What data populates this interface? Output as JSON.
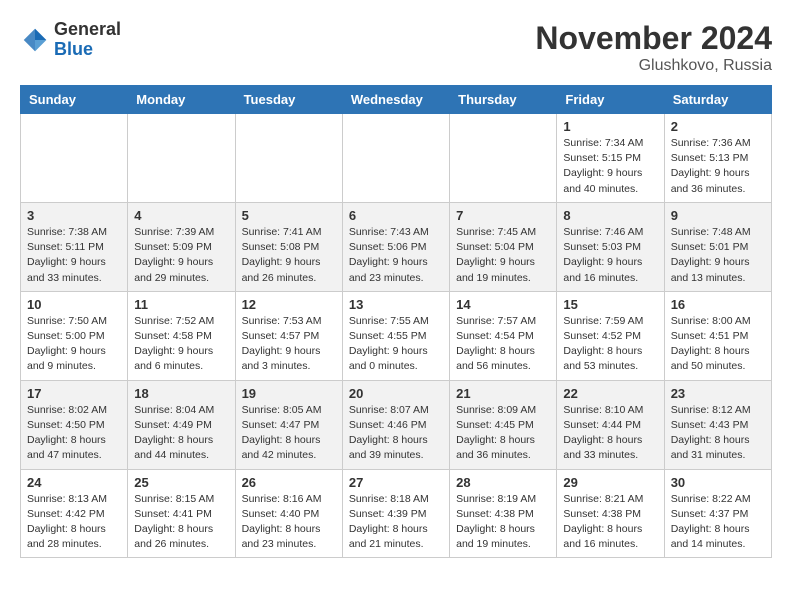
{
  "header": {
    "logo_general": "General",
    "logo_blue": "Blue",
    "month_title": "November 2024",
    "location": "Glushkovo, Russia"
  },
  "days_of_week": [
    "Sunday",
    "Monday",
    "Tuesday",
    "Wednesday",
    "Thursday",
    "Friday",
    "Saturday"
  ],
  "weeks": [
    [
      {
        "day": "",
        "info": ""
      },
      {
        "day": "",
        "info": ""
      },
      {
        "day": "",
        "info": ""
      },
      {
        "day": "",
        "info": ""
      },
      {
        "day": "",
        "info": ""
      },
      {
        "day": "1",
        "info": "Sunrise: 7:34 AM\nSunset: 5:15 PM\nDaylight: 9 hours and 40 minutes."
      },
      {
        "day": "2",
        "info": "Sunrise: 7:36 AM\nSunset: 5:13 PM\nDaylight: 9 hours and 36 minutes."
      }
    ],
    [
      {
        "day": "3",
        "info": "Sunrise: 7:38 AM\nSunset: 5:11 PM\nDaylight: 9 hours and 33 minutes."
      },
      {
        "day": "4",
        "info": "Sunrise: 7:39 AM\nSunset: 5:09 PM\nDaylight: 9 hours and 29 minutes."
      },
      {
        "day": "5",
        "info": "Sunrise: 7:41 AM\nSunset: 5:08 PM\nDaylight: 9 hours and 26 minutes."
      },
      {
        "day": "6",
        "info": "Sunrise: 7:43 AM\nSunset: 5:06 PM\nDaylight: 9 hours and 23 minutes."
      },
      {
        "day": "7",
        "info": "Sunrise: 7:45 AM\nSunset: 5:04 PM\nDaylight: 9 hours and 19 minutes."
      },
      {
        "day": "8",
        "info": "Sunrise: 7:46 AM\nSunset: 5:03 PM\nDaylight: 9 hours and 16 minutes."
      },
      {
        "day": "9",
        "info": "Sunrise: 7:48 AM\nSunset: 5:01 PM\nDaylight: 9 hours and 13 minutes."
      }
    ],
    [
      {
        "day": "10",
        "info": "Sunrise: 7:50 AM\nSunset: 5:00 PM\nDaylight: 9 hours and 9 minutes."
      },
      {
        "day": "11",
        "info": "Sunrise: 7:52 AM\nSunset: 4:58 PM\nDaylight: 9 hours and 6 minutes."
      },
      {
        "day": "12",
        "info": "Sunrise: 7:53 AM\nSunset: 4:57 PM\nDaylight: 9 hours and 3 minutes."
      },
      {
        "day": "13",
        "info": "Sunrise: 7:55 AM\nSunset: 4:55 PM\nDaylight: 9 hours and 0 minutes."
      },
      {
        "day": "14",
        "info": "Sunrise: 7:57 AM\nSunset: 4:54 PM\nDaylight: 8 hours and 56 minutes."
      },
      {
        "day": "15",
        "info": "Sunrise: 7:59 AM\nSunset: 4:52 PM\nDaylight: 8 hours and 53 minutes."
      },
      {
        "day": "16",
        "info": "Sunrise: 8:00 AM\nSunset: 4:51 PM\nDaylight: 8 hours and 50 minutes."
      }
    ],
    [
      {
        "day": "17",
        "info": "Sunrise: 8:02 AM\nSunset: 4:50 PM\nDaylight: 8 hours and 47 minutes."
      },
      {
        "day": "18",
        "info": "Sunrise: 8:04 AM\nSunset: 4:49 PM\nDaylight: 8 hours and 44 minutes."
      },
      {
        "day": "19",
        "info": "Sunrise: 8:05 AM\nSunset: 4:47 PM\nDaylight: 8 hours and 42 minutes."
      },
      {
        "day": "20",
        "info": "Sunrise: 8:07 AM\nSunset: 4:46 PM\nDaylight: 8 hours and 39 minutes."
      },
      {
        "day": "21",
        "info": "Sunrise: 8:09 AM\nSunset: 4:45 PM\nDaylight: 8 hours and 36 minutes."
      },
      {
        "day": "22",
        "info": "Sunrise: 8:10 AM\nSunset: 4:44 PM\nDaylight: 8 hours and 33 minutes."
      },
      {
        "day": "23",
        "info": "Sunrise: 8:12 AM\nSunset: 4:43 PM\nDaylight: 8 hours and 31 minutes."
      }
    ],
    [
      {
        "day": "24",
        "info": "Sunrise: 8:13 AM\nSunset: 4:42 PM\nDaylight: 8 hours and 28 minutes."
      },
      {
        "day": "25",
        "info": "Sunrise: 8:15 AM\nSunset: 4:41 PM\nDaylight: 8 hours and 26 minutes."
      },
      {
        "day": "26",
        "info": "Sunrise: 8:16 AM\nSunset: 4:40 PM\nDaylight: 8 hours and 23 minutes."
      },
      {
        "day": "27",
        "info": "Sunrise: 8:18 AM\nSunset: 4:39 PM\nDaylight: 8 hours and 21 minutes."
      },
      {
        "day": "28",
        "info": "Sunrise: 8:19 AM\nSunset: 4:38 PM\nDaylight: 8 hours and 19 minutes."
      },
      {
        "day": "29",
        "info": "Sunrise: 8:21 AM\nSunset: 4:38 PM\nDaylight: 8 hours and 16 minutes."
      },
      {
        "day": "30",
        "info": "Sunrise: 8:22 AM\nSunset: 4:37 PM\nDaylight: 8 hours and 14 minutes."
      }
    ]
  ]
}
